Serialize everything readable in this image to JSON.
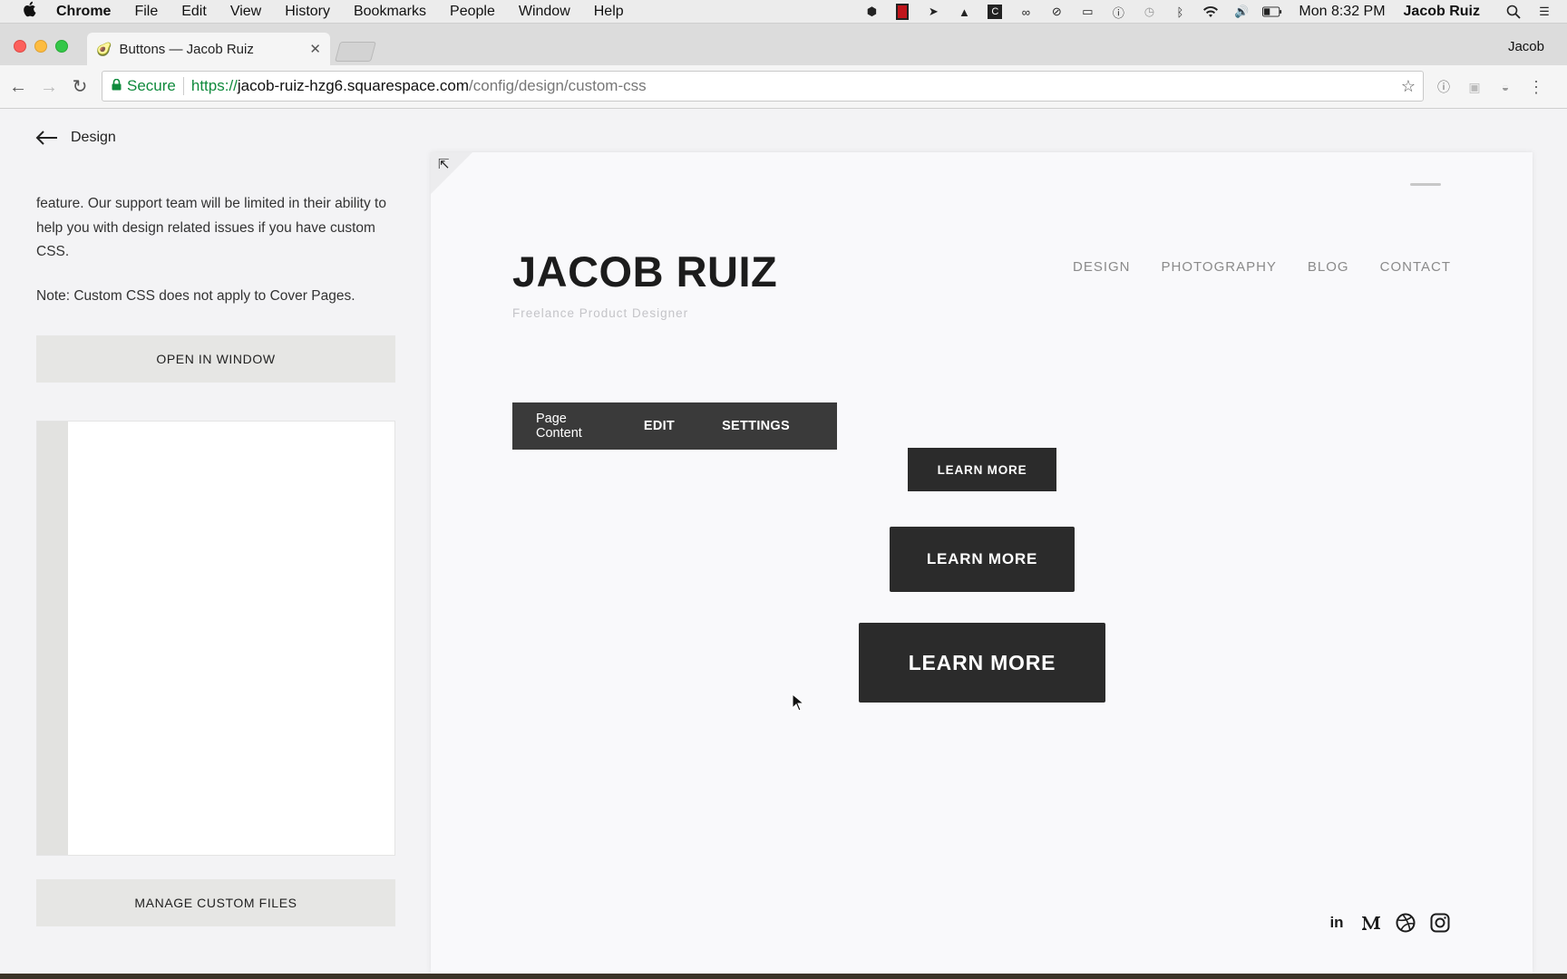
{
  "menubar": {
    "apple": "",
    "items": [
      "Chrome",
      "File",
      "Edit",
      "View",
      "History",
      "Bookmarks",
      "People",
      "Window",
      "Help"
    ],
    "clock": "Mon 8:32 PM",
    "user": "Jacob Ruiz"
  },
  "browser": {
    "tab_title": "Buttons — Jacob Ruiz",
    "tab_favicon": "🥑",
    "profile": "Jacob",
    "url": {
      "secure_label": "Secure",
      "scheme": "https://",
      "host": "jacob-ruiz-hzg6.squarespace.com",
      "path": "/config/design/custom-css"
    }
  },
  "sidebar": {
    "back_label": "Design",
    "help_text": "feature. Our support team will be limited in their ability to help you with design related issues if you have custom CSS.",
    "note": "Note: Custom CSS does not apply to Cover Pages.",
    "open_window_label": "OPEN IN WINDOW",
    "manage_files_label": "MANAGE CUSTOM FILES"
  },
  "preview": {
    "site_title": "JACOB RUIZ",
    "tagline": "Freelance Product Designer",
    "nav": [
      "DESIGN",
      "PHOTOGRAPHY",
      "BLOG",
      "CONTACT"
    ],
    "edit_bar": {
      "page_content": "Page Content",
      "edit": "EDIT",
      "settings": "SETTINGS"
    },
    "buttons": {
      "small": "LEARN MORE",
      "medium": "LEARN MORE",
      "large": "LEARN MORE"
    },
    "social_icons": [
      "linkedin-icon",
      "medium-icon",
      "dribbble-icon",
      "instagram-icon"
    ]
  },
  "colors": {
    "button_bg": "#2b2b2b",
    "edit_bar_bg": "#3a3a3a",
    "secure_green": "#0f8a3c"
  }
}
